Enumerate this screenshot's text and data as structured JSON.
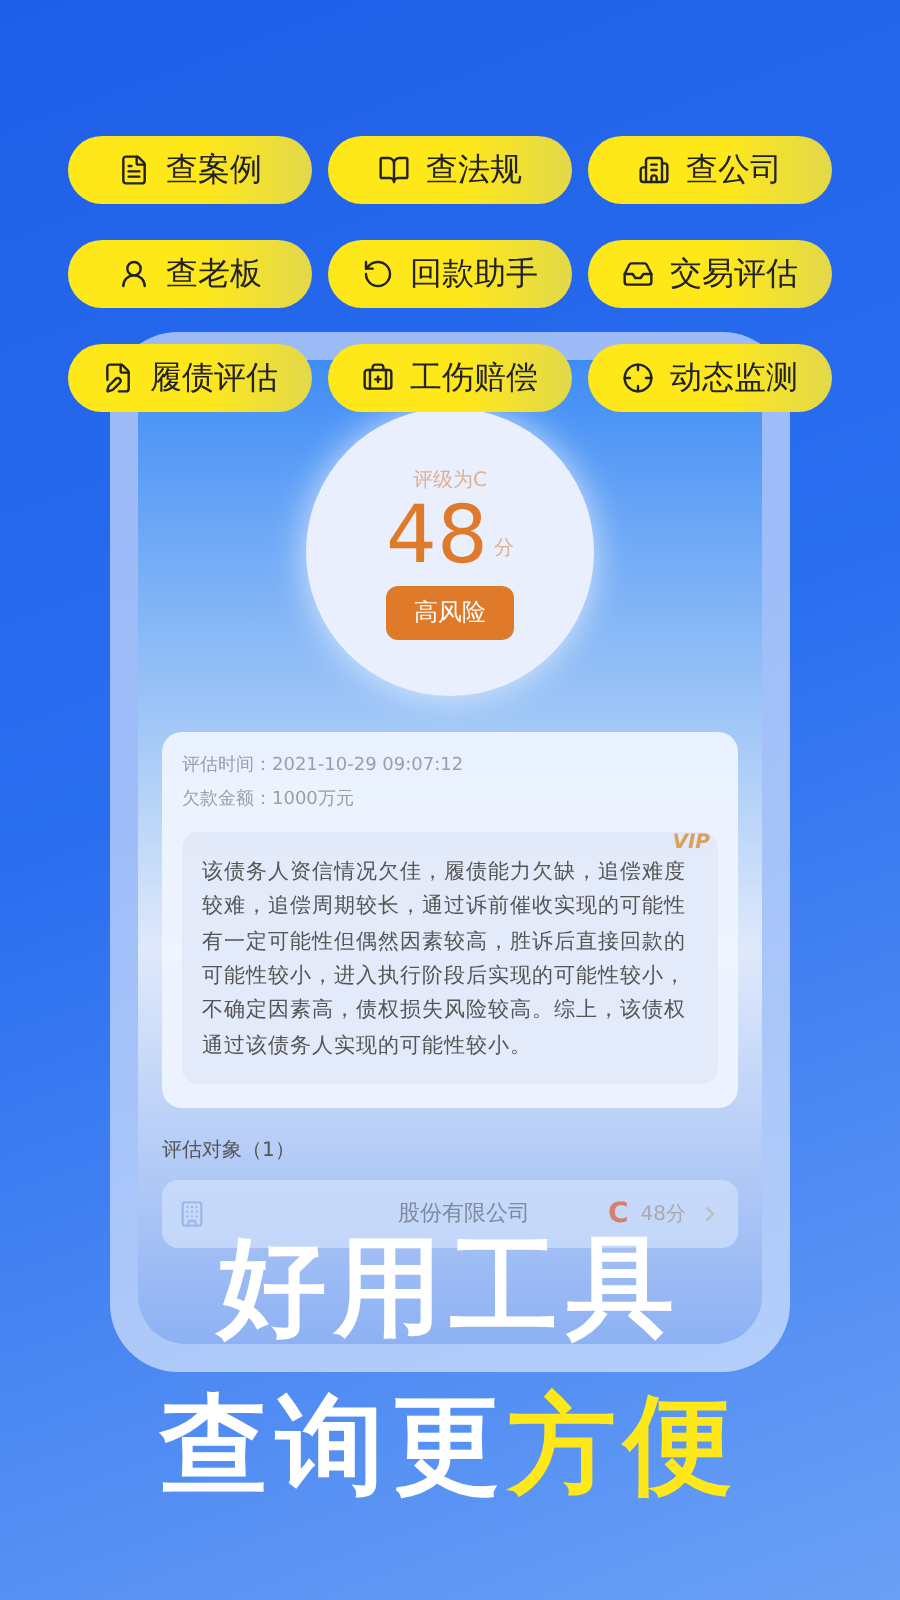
{
  "tools": [
    {
      "label": "查案例"
    },
    {
      "label": "查法规"
    },
    {
      "label": "查公司"
    },
    {
      "label": "查老板"
    },
    {
      "label": "回款助手"
    },
    {
      "label": "交易评估"
    },
    {
      "label": "履债评估"
    },
    {
      "label": "工伤赔偿"
    },
    {
      "label": "动态监测"
    }
  ],
  "rating": {
    "title": "评级为C",
    "score": "48",
    "unit": "分",
    "risk": "高风险"
  },
  "report": {
    "time_label": "评估时间：",
    "time": "2021-10-29 09:07:12",
    "amount_label": "欠款金额：",
    "amount": "1000万元",
    "badge": "VIP",
    "summary": "该债务人资信情况欠佳，履债能力欠缺，追偿难度较难，追偿周期较长，通过诉前催收实现的可能性有一定可能性但偶然因素较高，胜诉后直接回款的可能性较小，进入执行阶段后实现的可能性较小，不确定因素高，债权损失风险较高。综上，该债权通过该债务人实现的可能性较小。"
  },
  "targets": {
    "title": "评估对象（1）",
    "items": [
      {
        "name": "股份有限公司",
        "grade": "C",
        "score": "48分"
      }
    ]
  },
  "headline": {
    "line1": [
      {
        "text": "好用工具",
        "highlight": false
      }
    ],
    "line2": [
      {
        "text": "查询更",
        "highlight": false
      },
      {
        "text": "方便",
        "highlight": true
      }
    ]
  }
}
